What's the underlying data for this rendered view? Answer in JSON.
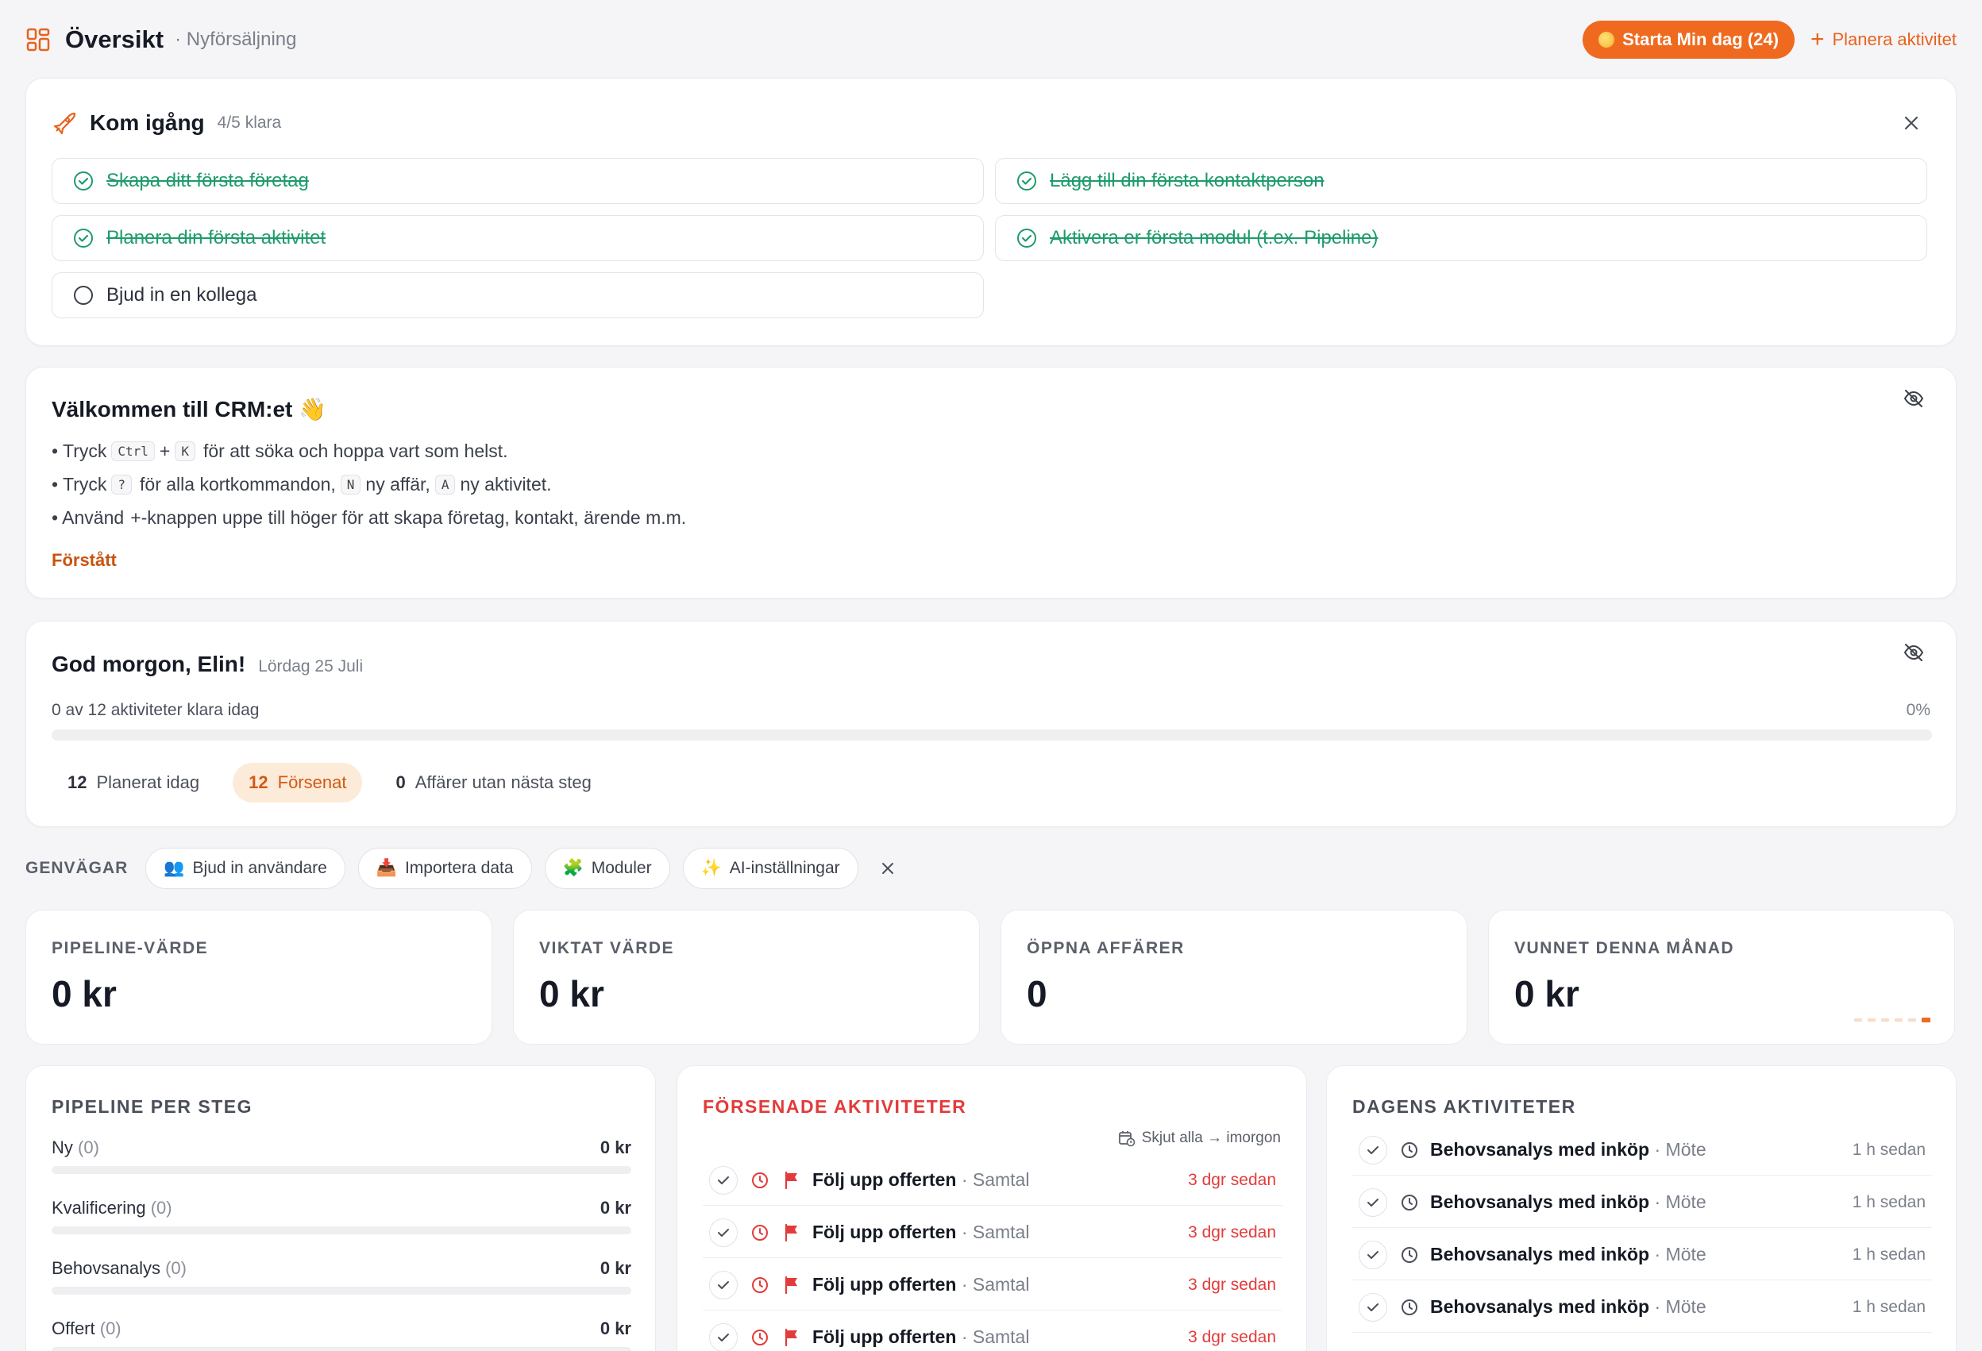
{
  "header": {
    "title": "Översikt",
    "subtitle": "· Nyförsäljning",
    "start_day_label": "Starta Min dag (24)",
    "plan_activity_label": "Planera aktivitet"
  },
  "getting_started": {
    "title": "Kom igång",
    "count": "4/5 klara",
    "tasks": [
      {
        "label": "Skapa ditt första företag",
        "done": true
      },
      {
        "label": "Lägg till din första kontaktperson",
        "done": true
      },
      {
        "label": "Planera din första aktivitet",
        "done": true
      },
      {
        "label": "Aktivera er första modul (t.ex. Pipeline)",
        "done": true
      },
      {
        "label": "Bjud in en kollega",
        "done": false
      }
    ]
  },
  "welcome": {
    "title": "Välkommen till CRM:et 👋",
    "line1": {
      "a": "• Tryck",
      "k1": "Ctrl",
      "plus": "+",
      "k2": "K",
      "b": "för att söka och hoppa vart som helst."
    },
    "line2": {
      "a": "• Tryck",
      "k1": "?",
      "b": "för alla kortkommandon,",
      "k2": "N",
      "c": "ny affär,",
      "k3": "A",
      "d": "ny aktivitet."
    },
    "line3": {
      "a": "• Använd",
      "k1": "+",
      "b": "-knappen uppe till höger för att skapa företag, kontakt, ärende m.m."
    },
    "ok_label": "Förstått"
  },
  "morning": {
    "greeting": "God morgon, Elin!",
    "date": "Lördag 25 Juli",
    "progress_text": "0 av 12 aktiviteter klara idag",
    "progress_pct": "0%",
    "progress_value": 0,
    "chips": [
      {
        "num": "12",
        "label": "Planerat idag"
      },
      {
        "num": "12",
        "label": "Försenat"
      },
      {
        "num": "0",
        "label": "Affärer utan nästa steg"
      }
    ]
  },
  "shortcuts": {
    "label": "GENVÄGAR",
    "items": [
      {
        "label": "Bjud in användare",
        "emoji": "👥"
      },
      {
        "label": "Importera data",
        "emoji": "📥"
      },
      {
        "label": "Moduler",
        "emoji": "🧩"
      },
      {
        "label": "AI-inställningar",
        "emoji": "✨"
      }
    ]
  },
  "kpis": [
    {
      "label": "PIPELINE-VÄRDE",
      "value": "0 kr"
    },
    {
      "label": "VIKTAT VÄRDE",
      "value": "0 kr"
    },
    {
      "label": "ÖPPNA AFFÄRER",
      "value": "0"
    },
    {
      "label": "VUNNET DENNA MÅNAD",
      "value": "0 kr"
    }
  ],
  "pipeline": {
    "title": "PIPELINE PER STEG",
    "stages": [
      {
        "name": "Ny",
        "count": "(0)",
        "amount": "0 kr"
      },
      {
        "name": "Kvalificering",
        "count": "(0)",
        "amount": "0 kr"
      },
      {
        "name": "Behovsanalys",
        "count": "(0)",
        "amount": "0 kr"
      },
      {
        "name": "Offert",
        "count": "(0)",
        "amount": "0 kr"
      }
    ]
  },
  "overdue": {
    "title": "FÖRSENADE AKTIVITETER",
    "postpone_label": "Skjut alla → imorgon",
    "items": [
      {
        "title": "Följ upp offerten",
        "type": "· Samtal",
        "when": "3 dgr sedan"
      },
      {
        "title": "Följ upp offerten",
        "type": "· Samtal",
        "when": "3 dgr sedan"
      },
      {
        "title": "Följ upp offerten",
        "type": "· Samtal",
        "when": "3 dgr sedan"
      },
      {
        "title": "Följ upp offerten",
        "type": "· Samtal",
        "when": "3 dgr sedan"
      }
    ]
  },
  "today": {
    "title": "DAGENS AKTIVITETER",
    "items": [
      {
        "title": "Behovsanalys med inköp",
        "type": "· Möte",
        "when": "1 h sedan"
      },
      {
        "title": "Behovsanalys med inköp",
        "type": "· Möte",
        "when": "1 h sedan"
      },
      {
        "title": "Behovsanalys med inköp",
        "type": "· Möte",
        "when": "1 h sedan"
      },
      {
        "title": "Behovsanalys med inköp",
        "type": "· Möte",
        "when": "1 h sedan"
      }
    ]
  },
  "colors": {
    "accent": "#ef6a1f",
    "success": "#1e9b6c",
    "danger": "#e23b3b"
  }
}
